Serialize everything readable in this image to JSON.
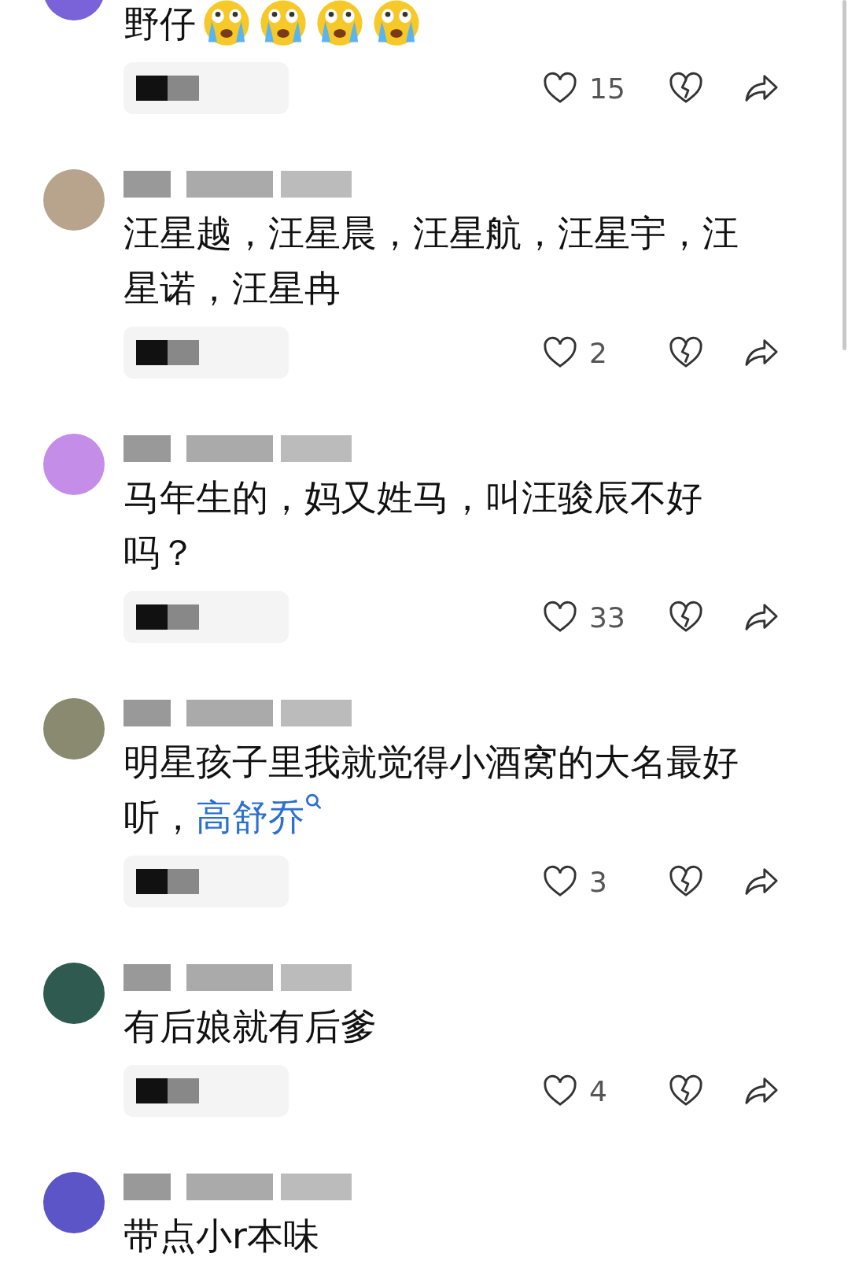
{
  "comments": [
    {
      "color": "#7a62d8",
      "body": [
        {
          "kind": "text",
          "text": "野仔"
        },
        {
          "kind": "emoji"
        },
        {
          "kind": "emoji"
        },
        {
          "kind": "emoji"
        },
        {
          "kind": "emoji"
        }
      ],
      "likes": "15"
    },
    {
      "color": "#b8a48c",
      "body": [
        {
          "kind": "text",
          "text": "汪星越，汪星晨，汪星航，汪星宇，汪星诺，汪星冉"
        }
      ],
      "likes": "2"
    },
    {
      "color": "#c48de8",
      "body": [
        {
          "kind": "text",
          "text": "马年生的，妈又姓马，叫汪骏辰不好吗？"
        }
      ],
      "likes": "33"
    },
    {
      "color": "#8a8a70",
      "body": [
        {
          "kind": "text",
          "text": "明星孩子里我就觉得小酒窝的大名最好听，"
        },
        {
          "kind": "link",
          "text": "高舒乔"
        }
      ],
      "likes": "3"
    },
    {
      "color": "#2e5a50",
      "body": [
        {
          "kind": "text",
          "text": "有后娘就有后爹"
        }
      ],
      "likes": "4"
    },
    {
      "color": "#5b55c8",
      "body": [
        {
          "kind": "text",
          "text": "带点小r本味"
        }
      ]
    }
  ]
}
